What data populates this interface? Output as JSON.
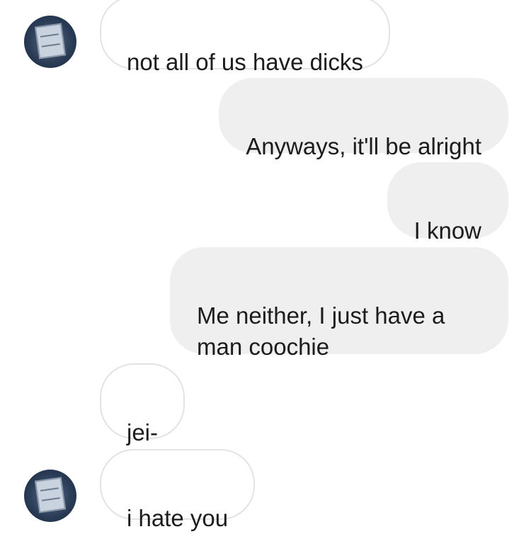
{
  "messages": [
    {
      "direction": "incoming",
      "text": "not all of us have dicks"
    },
    {
      "direction": "outgoing",
      "text": "Anyways, it'll be alright"
    },
    {
      "direction": "outgoing",
      "text": "I know"
    },
    {
      "direction": "outgoing",
      "text": "Me neither, I just have a\nman coochie"
    },
    {
      "direction": "incoming",
      "text": "jei-"
    },
    {
      "direction": "incoming",
      "text": "i hate you"
    }
  ],
  "colors": {
    "incoming_bubble": "#ffffff",
    "incoming_border": "#e3e3e3",
    "outgoing_bubble": "#efefef",
    "text": "#1c1c1c"
  },
  "avatar": {
    "icon": "profile-picture-paper-icon"
  }
}
